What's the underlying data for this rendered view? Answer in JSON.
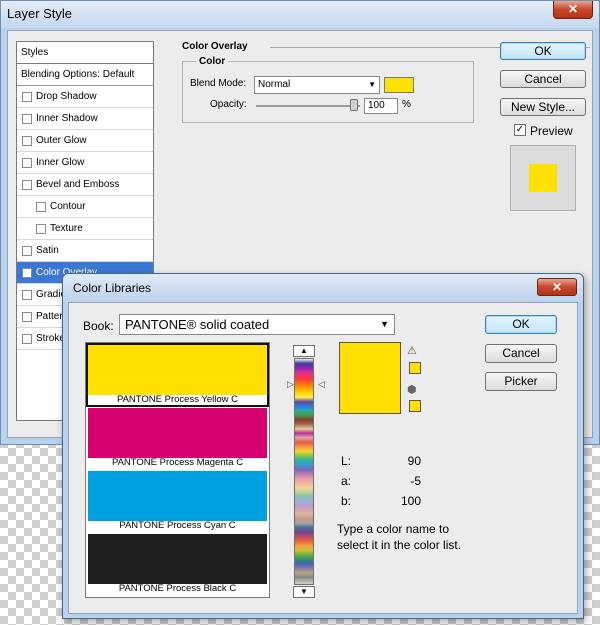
{
  "layer_style": {
    "title": "Layer Style",
    "close_glyph": "✕",
    "styles_header": "Styles",
    "blending_options": "Blending Options: Default",
    "styles": [
      {
        "label": "Drop Shadow",
        "checked": false,
        "level": 0
      },
      {
        "label": "Inner Shadow",
        "checked": false,
        "level": 0
      },
      {
        "label": "Outer Glow",
        "checked": false,
        "level": 0
      },
      {
        "label": "Inner Glow",
        "checked": false,
        "level": 0
      },
      {
        "label": "Bevel and Emboss",
        "checked": false,
        "level": 0
      },
      {
        "label": "Contour",
        "checked": false,
        "level": 1
      },
      {
        "label": "Texture",
        "checked": false,
        "level": 1
      },
      {
        "label": "Satin",
        "checked": false,
        "level": 0
      },
      {
        "label": "Color Overlay",
        "checked": true,
        "level": 0,
        "active": true
      },
      {
        "label": "Gradient Overlay",
        "checked": false,
        "level": 0
      },
      {
        "label": "Pattern Overlay",
        "checked": false,
        "level": 0
      },
      {
        "label": "Stroke",
        "checked": false,
        "level": 0
      }
    ],
    "color_overlay": {
      "group_title": "Color Overlay",
      "sub_title": "Color",
      "blend_mode_label": "Blend Mode:",
      "blend_mode_value": "Normal",
      "overlay_color": "#ffe000",
      "opacity_label": "Opacity:",
      "opacity_value": "100",
      "opacity_unit": "%",
      "opacity_level": 1.0
    },
    "buttons": {
      "ok": "OK",
      "cancel": "Cancel",
      "new_style": "New Style..."
    },
    "preview_label": "Preview",
    "preview_checked": true
  },
  "color_libraries": {
    "title": "Color Libraries",
    "close_glyph": "✕",
    "book_label": "Book:",
    "book_value": "PANTONE® solid coated",
    "swatches": [
      {
        "name": "PANTONE Process Yellow C",
        "color": "#ffe000",
        "selected": true
      },
      {
        "name": "PANTONE Process Magenta C",
        "color": "#d6006e",
        "selected": false
      },
      {
        "name": "PANTONE Process Cyan C",
        "color": "#009fdf",
        "selected": false
      },
      {
        "name": "PANTONE Process Black C",
        "color": "#1e1e1e",
        "selected": false
      }
    ],
    "current_color": "#ffe000",
    "lab": [
      {
        "key": "L:",
        "value": "90"
      },
      {
        "key": "a:",
        "value": "-5"
      },
      {
        "key": "b:",
        "value": "100"
      }
    ],
    "hint_line1": "Type a color name to",
    "hint_line2": "select it in the color list.",
    "buttons": {
      "ok": "OK",
      "cancel": "Cancel",
      "picker": "Picker"
    },
    "icons": {
      "gamut_warning": "⚠",
      "web_safe": "⬢"
    }
  }
}
